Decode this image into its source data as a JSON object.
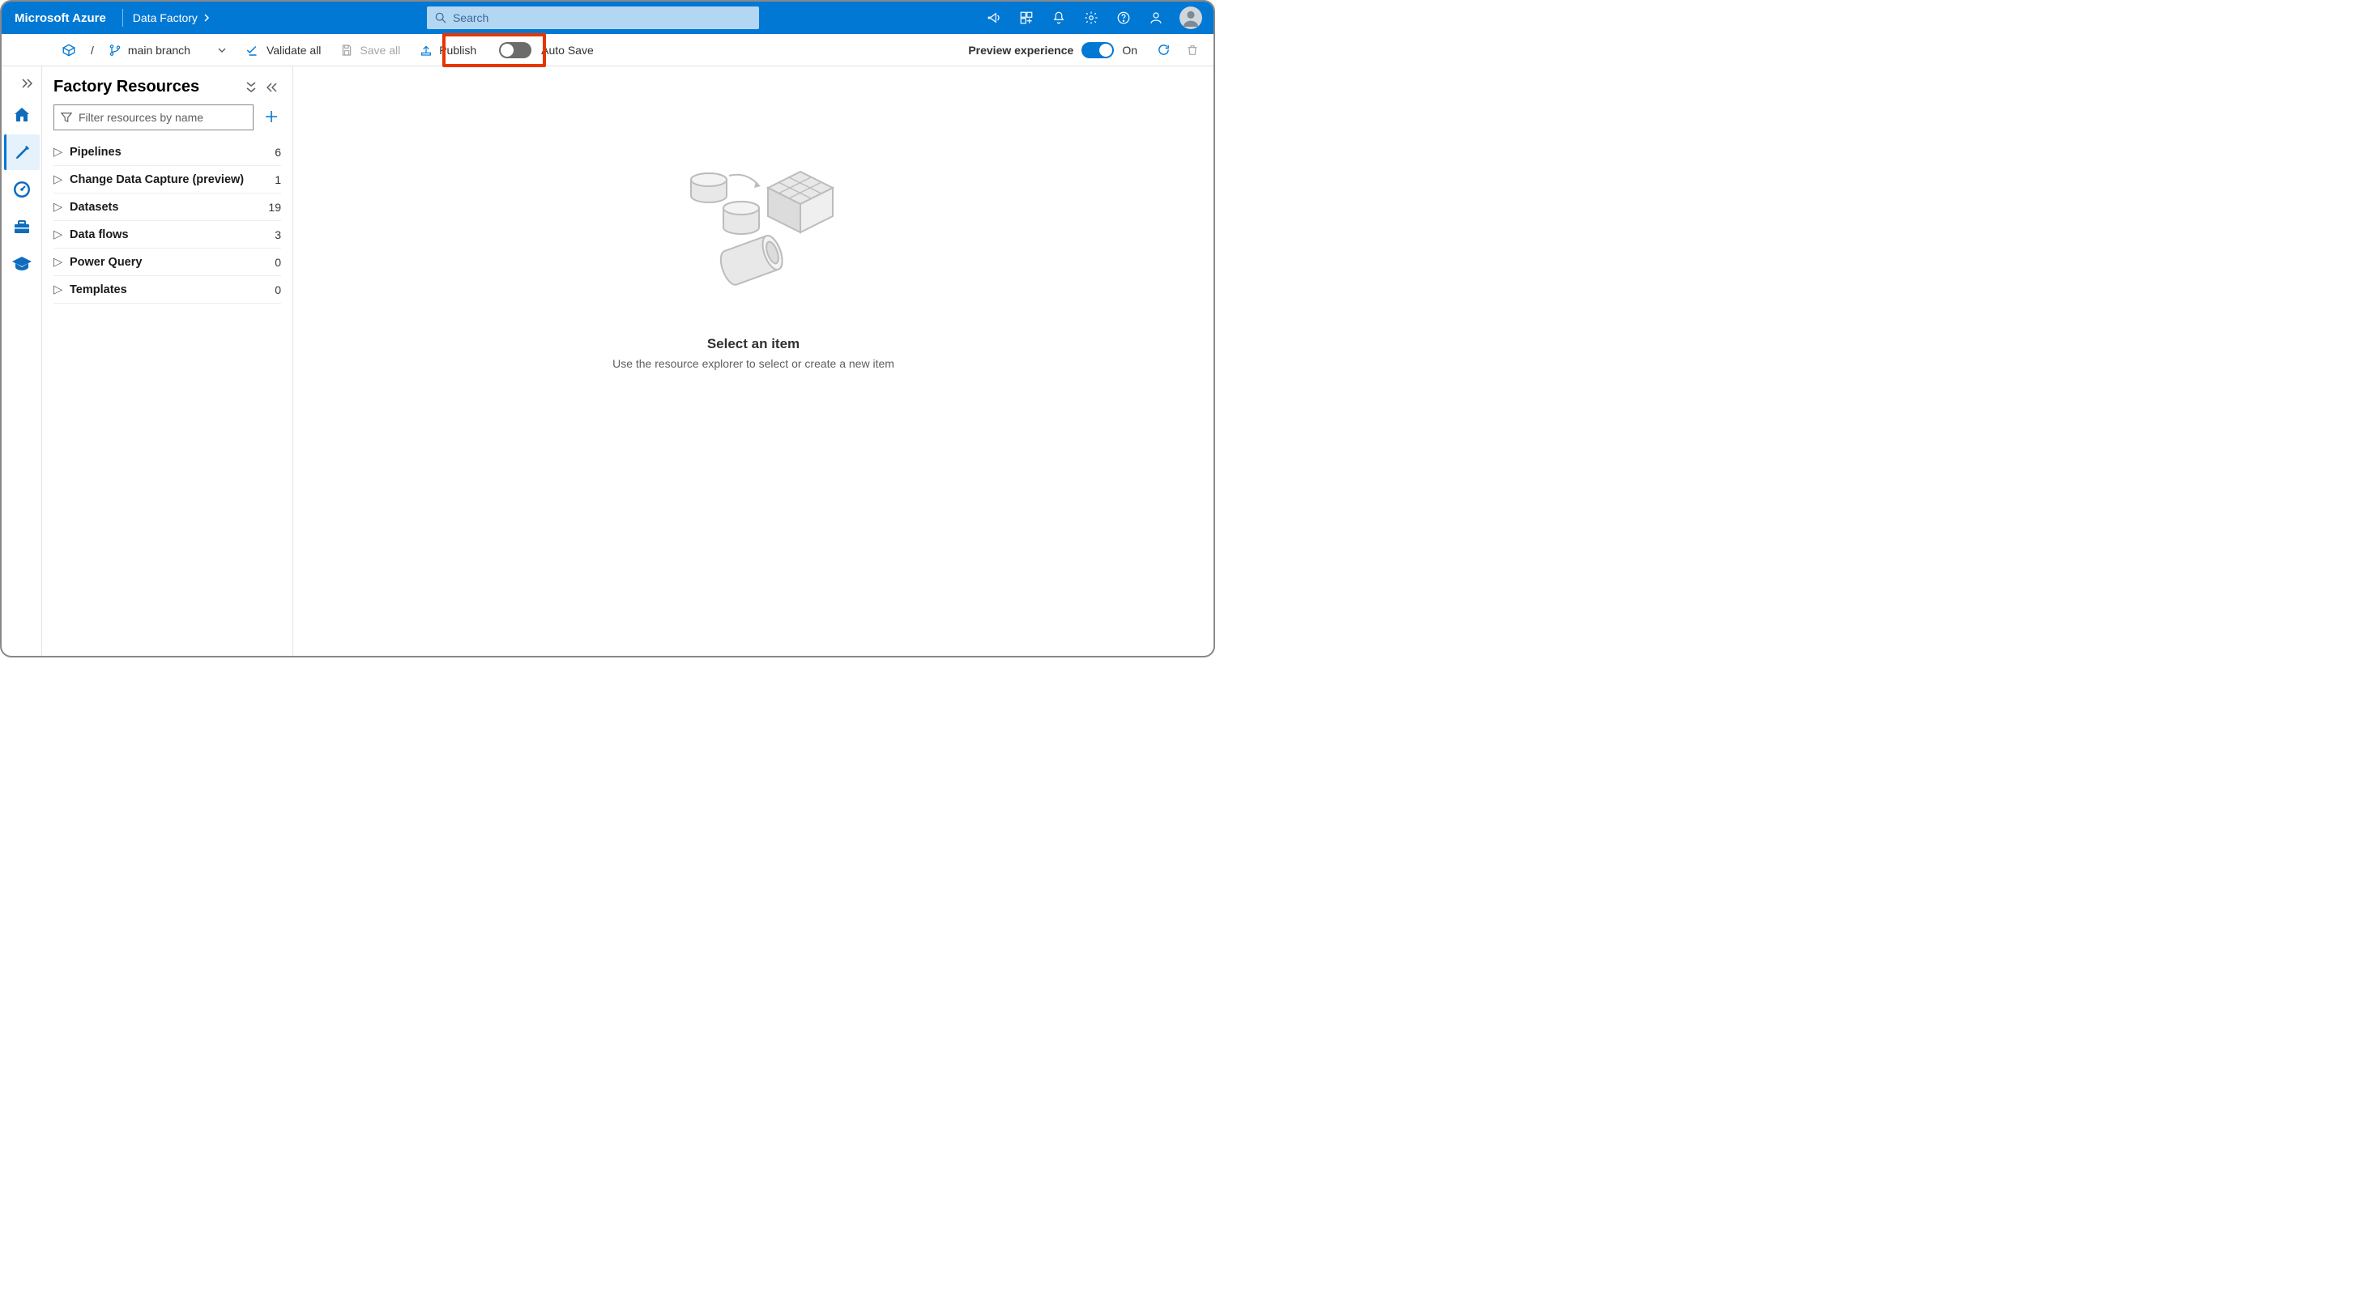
{
  "header": {
    "brand": "Microsoft Azure",
    "crumb": "Data Factory",
    "search_placeholder": "Search"
  },
  "toolbar": {
    "branch_label": "main branch",
    "validate_label": "Validate all",
    "save_all_label": "Save all",
    "publish_label": "Publish",
    "autosave_label": "Auto Save",
    "preview_label": "Preview experience",
    "preview_toggle_label": "On",
    "autosave_on": false,
    "preview_on": true
  },
  "resources": {
    "title": "Factory Resources",
    "filter_placeholder": "Filter resources by name",
    "items": [
      {
        "label": "Pipelines",
        "count": "6"
      },
      {
        "label": "Change Data Capture (preview)",
        "count": "1"
      },
      {
        "label": "Datasets",
        "count": "19"
      },
      {
        "label": "Data flows",
        "count": "3"
      },
      {
        "label": "Power Query",
        "count": "0"
      },
      {
        "label": "Templates",
        "count": "0"
      }
    ]
  },
  "canvas": {
    "title": "Select an item",
    "subtitle": "Use the resource explorer to select or create a new item"
  }
}
